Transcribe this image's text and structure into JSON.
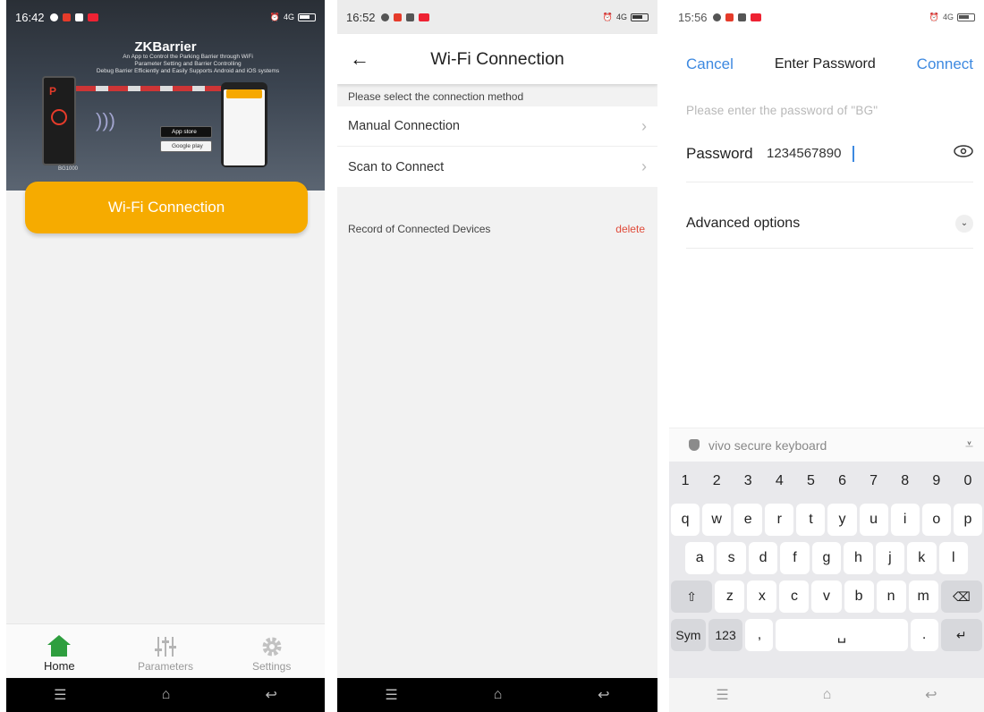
{
  "home": {
    "status_time": "16:42",
    "status_net": "4G",
    "banner": {
      "title": "ZKBarrier",
      "subtitle_line1": "An App to Control the Parking Barrier through WiFi",
      "subtitle_line2": "Parameter Setting and Barrier Controlling",
      "subtitle_line3": "Debug Barrier Efficiently and Easily Supports Android and iOS systems",
      "post_label": "BG1000",
      "app_store": "App store",
      "google_play": "Google play"
    },
    "wifi_button": "Wi-Fi Connection",
    "tabs": [
      {
        "label": "Home",
        "icon": "home-icon",
        "active": true
      },
      {
        "label": "Parameters",
        "icon": "sliders-icon",
        "active": false
      },
      {
        "label": "Settings",
        "icon": "gear-icon",
        "active": false
      }
    ],
    "accent": "#F6AB00",
    "active_tab_color": "#2E9E3E"
  },
  "wifi_connection": {
    "status_time": "16:52",
    "status_net": "4G",
    "title": "Wi-Fi Connection",
    "section_hint": "Please select the connection method",
    "methods": [
      {
        "label": "Manual Connection"
      },
      {
        "label": "Scan to Connect"
      }
    ],
    "record_label": "Record of Connected Devices",
    "delete_label": "delete",
    "delete_color": "#E04B3A"
  },
  "password_dialog": {
    "status_time": "15:56",
    "status_net": "4G",
    "cancel": "Cancel",
    "title": "Enter Password",
    "connect": "Connect",
    "hint": "Please enter the password of \"BG\"",
    "password_label": "Password",
    "password_value": "1234567890",
    "advanced": "Advanced options",
    "keyboard_name": "vivo secure keyboard",
    "link_color": "#3D89E0",
    "keys": {
      "row1": [
        "1",
        "2",
        "3",
        "4",
        "5",
        "6",
        "7",
        "8",
        "9",
        "0"
      ],
      "row2": [
        "q",
        "w",
        "e",
        "r",
        "t",
        "y",
        "u",
        "i",
        "o",
        "p"
      ],
      "row3": [
        "a",
        "s",
        "d",
        "f",
        "g",
        "h",
        "j",
        "k",
        "l"
      ],
      "row4": [
        "z",
        "x",
        "c",
        "v",
        "b",
        "n",
        "m"
      ],
      "sym": "Sym",
      "num": "123",
      "comma": ",",
      "period": "."
    }
  }
}
